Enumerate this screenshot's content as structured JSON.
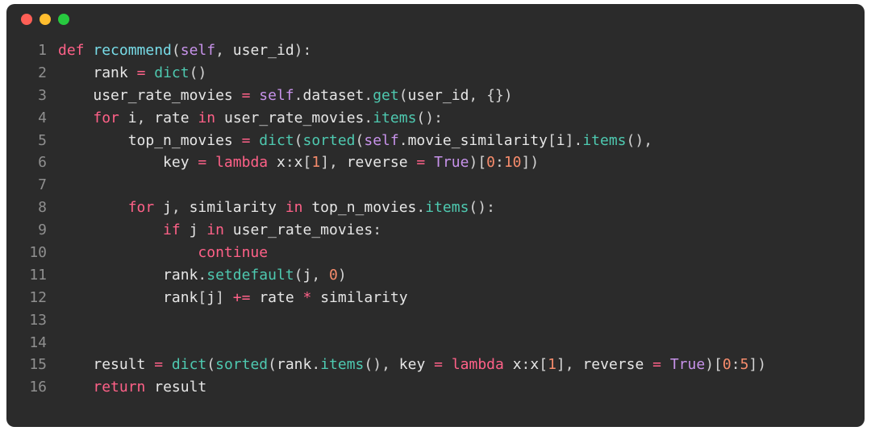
{
  "colors": {
    "background": "#2b2b2b",
    "red_dot": "#ff5f56",
    "yellow_dot": "#ffbd2e",
    "green_dot": "#27c93f",
    "keyword": "#ff6188",
    "function": "#78dce8",
    "call": "#4ec9b0",
    "self": "#c792ea",
    "number": "#f78c6c"
  },
  "tokens": {
    "def": "def",
    "recommend": "recommend",
    "self": "self",
    "user_id": "user_id",
    "rank": "rank",
    "dict": "dict",
    "user_rate_movies": "user_rate_movies",
    "dataset": "dataset",
    "get": "get",
    "empty_dict": "{}",
    "for": "for",
    "i": "i",
    "rate": "rate",
    "in": "in",
    "items": "items",
    "top_n_movies": "top_n_movies",
    "sorted": "sorted",
    "movie_similarity": "movie_similarity",
    "key": "key",
    "lambda": "lambda",
    "x": "x",
    "reverse": "reverse",
    "True": "True",
    "slice_0_10": "10",
    "j": "j",
    "similarity": "similarity",
    "if": "if",
    "continue": "continue",
    "setdefault": "setdefault",
    "zero": "0",
    "one": "1",
    "plus_equals": "+=",
    "times": "*",
    "result": "result",
    "slice_0_5": "5",
    "return": "return",
    "eq": "=",
    "colon": ":",
    "comma": ", ",
    "dot": ".",
    "lparen": "(",
    "rparen": ")",
    "lbrack": "[",
    "rbrack": "]"
  },
  "line_numbers": [
    "1",
    "2",
    "3",
    "4",
    "5",
    "6",
    "7",
    "8",
    "9",
    "10",
    "11",
    "12",
    "13",
    "14",
    "15",
    "16"
  ]
}
